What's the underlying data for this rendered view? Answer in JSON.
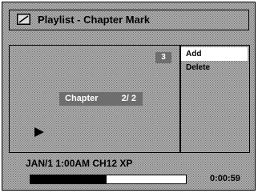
{
  "window": {
    "title": "Playlist - Chapter Mark"
  },
  "title_icon": "playlist-tab-icon",
  "chapter_marker": "3",
  "chapter_info": {
    "label": "Chapter",
    "count": "2/ 2"
  },
  "play_icon": "play-icon",
  "menu": {
    "items": [
      {
        "label": "Add",
        "selected": true
      },
      {
        "label": "Delete",
        "selected": false
      }
    ]
  },
  "status": {
    "info": "JAN/1  1:00AM CH12  XP"
  },
  "playback": {
    "progress": 0.49,
    "time": "0:00:59"
  }
}
